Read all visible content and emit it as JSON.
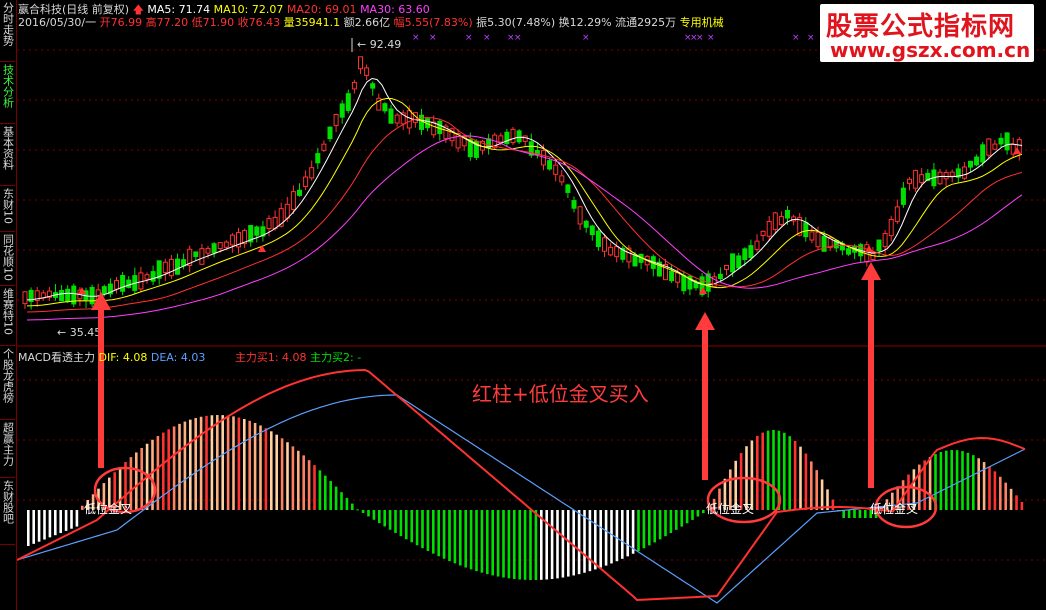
{
  "rail": [
    {
      "label": "分时走势",
      "active": false
    },
    {
      "label": "技术分析",
      "active": true
    },
    {
      "label": "基本资料",
      "active": false
    },
    {
      "label": "东财10",
      "active": false
    },
    {
      "label": "同花顺10",
      "active": false
    },
    {
      "label": "维赛特10",
      "active": false
    },
    {
      "label": "个股龙虎榜",
      "active": false
    },
    {
      "label": "超赢主力",
      "active": false
    },
    {
      "label": "东财股吧",
      "active": false
    }
  ],
  "header": {
    "stock": "嬴合科技(日线 前复权)",
    "ma5": "MA5: 71.74",
    "ma10": "MA10: 72.07",
    "ma20": "MA20: 69.01",
    "ma30": "MA30: 63.60",
    "date": "2016/05/30/一",
    "open": "开76.99",
    "high": "高77.20",
    "low": "低71.90",
    "close": "收76.43",
    "volume": "量35941.1",
    "amount": "额2.66亿",
    "change": "幅5.55(7.83%)",
    "amplitude": "振5.30(7.48%)",
    "turnover": "换12.29%",
    "float": "流通2925万",
    "industry": "专用机械"
  },
  "macd_header": {
    "name": "MACD看透主力",
    "dif": "DIF: 4.08",
    "dea": "DEA: 4.03",
    "buy1": "主力买1: 4.08",
    "buy2": "主力买2: -"
  },
  "watermark": {
    "line1": "股票公式指标网",
    "line2": "www.gszx.com.cn"
  },
  "annotation": "红柱+低位金叉买入",
  "signal_label": "低位金叉",
  "price_marks": {
    "high": "92.49",
    "low": "35.45"
  },
  "colors": {
    "up": "#ff3232",
    "down": "#00e000",
    "ma5": "#ffffff",
    "ma10": "#ffff00",
    "ma20": "#ff3232",
    "ma30": "#ff40ff",
    "dif": "#ff3232",
    "dea": "#5aa0ff",
    "annotation": "#ff3b3b"
  }
}
